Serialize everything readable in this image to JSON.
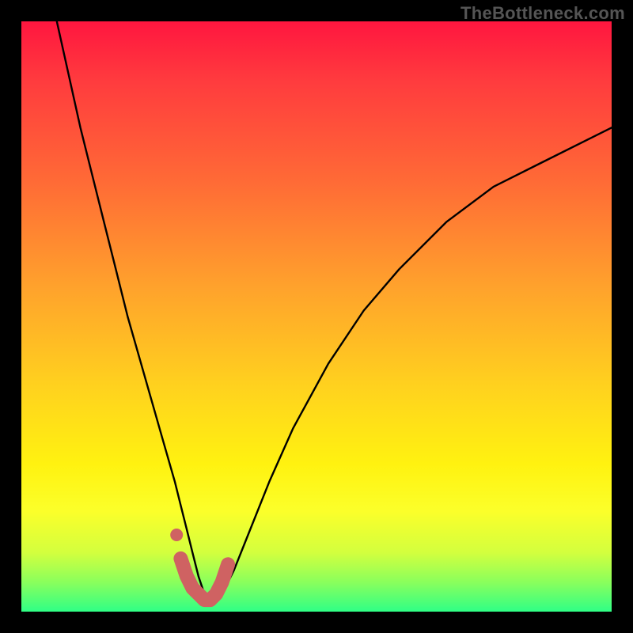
{
  "watermark": "TheBottleneck.com",
  "chart_data": {
    "type": "line",
    "title": "",
    "xlabel": "",
    "ylabel": "",
    "xlim": [
      0,
      100
    ],
    "ylim": [
      0,
      100
    ],
    "series": [
      {
        "name": "bottleneck-curve",
        "x": [
          6,
          8,
          10,
          12,
          14,
          16,
          18,
          20,
          22,
          24,
          26,
          27,
          28,
          29,
          30,
          31,
          32,
          33,
          34,
          36,
          38,
          42,
          46,
          52,
          58,
          64,
          72,
          80,
          88,
          96,
          100
        ],
        "values": [
          100,
          91,
          82,
          74,
          66,
          58,
          50,
          43,
          36,
          29,
          22,
          18,
          14,
          10,
          6,
          3,
          2,
          2,
          3,
          7,
          12,
          22,
          31,
          42,
          51,
          58,
          66,
          72,
          76,
          80,
          82
        ]
      }
    ],
    "marker": {
      "name": "highlight-segment",
      "x": [
        27,
        28,
        29,
        30,
        31,
        32,
        33,
        34,
        35
      ],
      "values": [
        9,
        6,
        4,
        3,
        2,
        2,
        3,
        5,
        8
      ],
      "color": "#cf6262"
    },
    "marker_dot": {
      "x": 26.3,
      "y": 13,
      "color": "#cf6262"
    },
    "gradient_stops": [
      {
        "pos": 0,
        "color": "#ff163f"
      },
      {
        "pos": 27,
        "color": "#ff6a36"
      },
      {
        "pos": 62,
        "color": "#ffd21e"
      },
      {
        "pos": 90,
        "color": "#d3ff3e"
      },
      {
        "pos": 100,
        "color": "#2fff86"
      }
    ]
  }
}
